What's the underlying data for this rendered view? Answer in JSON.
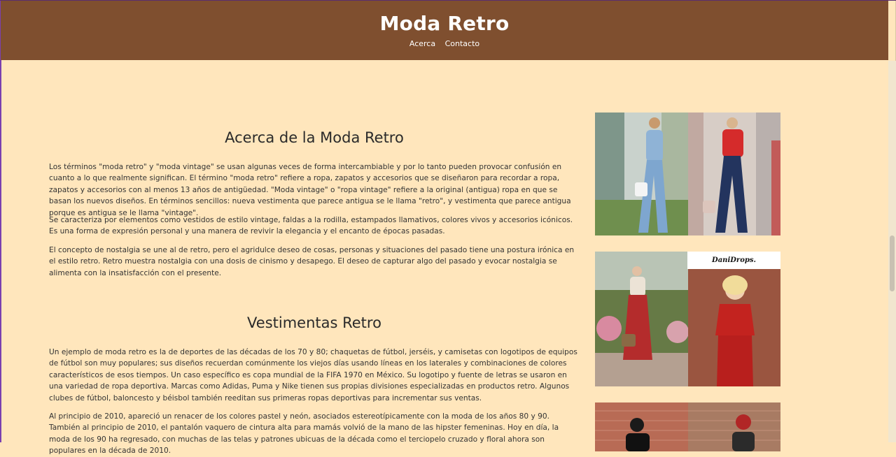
{
  "site": {
    "title": "Moda Retro",
    "nav": [
      "Acerca",
      "Contacto"
    ]
  },
  "about": {
    "heading": "Acerca de la Moda Retro",
    "paragraphs": [
      "Los términos \"moda retro\" y \"moda vintage\" se usan algunas veces de forma intercambiable y por lo tanto pueden provocar confusión en cuanto a lo que realmente significan. El término \"moda retro\" refiere a ropa, zapatos y accesorios que se diseñaron para recordar a ropa, zapatos y accesorios con al menos 13 años de antigüedad. \"Moda vintage\" o \"ropa vintage\" refiere a la original (antigua) ropa en que se basan los nuevos diseños. En términos sencillos: nueva vestimenta que parece antigua se le llama \"retro\", y vestimenta que parece antigua porque es antigua se le llama \"vintage\".",
      "Se caracteriza por elementos como vestidos de estilo vintage, faldas a la rodilla, estampados llamativos, colores vivos y accesorios icónicos. Es una forma de expresión personal y una manera de revivir la elegancia y el encanto de épocas pasadas.",
      "El concepto de nostalgia se une al de retro, pero el agridulce deseo de cosas, personas y situaciones del pasado tiene una postura irónica en el estilo retro. Retro muestra nostalgia con una dosis de cinismo y desapego. El deseo de capturar algo del pasado y evocar nostalgia se alimenta con la insatisfacción con el presente."
    ]
  },
  "clothing": {
    "heading": "Vestimentas Retro",
    "paragraphs": [
      "Un ejemplo de moda retro es la de deportes de las décadas de los 70 y 80; chaquetas de fútbol, jerséis, y camisetas con logotipos de equipos de fútbol son muy populares; sus diseños recuerdan comúnmente los viejos días usando líneas en los laterales y combinaciones de colores característicos de esos tiempos. Un caso específico es copa mundial de la FIFA 1970 en México. Su logotipo y fuente de letras se usaron en una variedad de ropa deportiva. Marcas como Adidas, Puma y Nike tienen sus propias divisiones especializadas en productos retro. Algunos clubes de fútbol, baloncesto y béisbol también reeditan sus primeras ropas deportivas para incrementar sus ventas.",
      "Al principio de 2010, apareció un renacer de los colores pastel y neón, asociados estereotípicamente con la moda de los años 80 y 90. También al principio de 2010, el pantalón vaquero de cintura alta para mamás volvió de la mano de las hipster femeninas. Hoy en día, la moda de los 90 ha regresado, con muchas de las telas y patrones ubicuas de la década como el terciopelo cruzado y floral ahora son populares en la década de 2010."
    ]
  },
  "gallery": {
    "watermark": "DaniDrops."
  },
  "colors": {
    "header": "#7f4f2f",
    "background": "#ffe6bc"
  }
}
